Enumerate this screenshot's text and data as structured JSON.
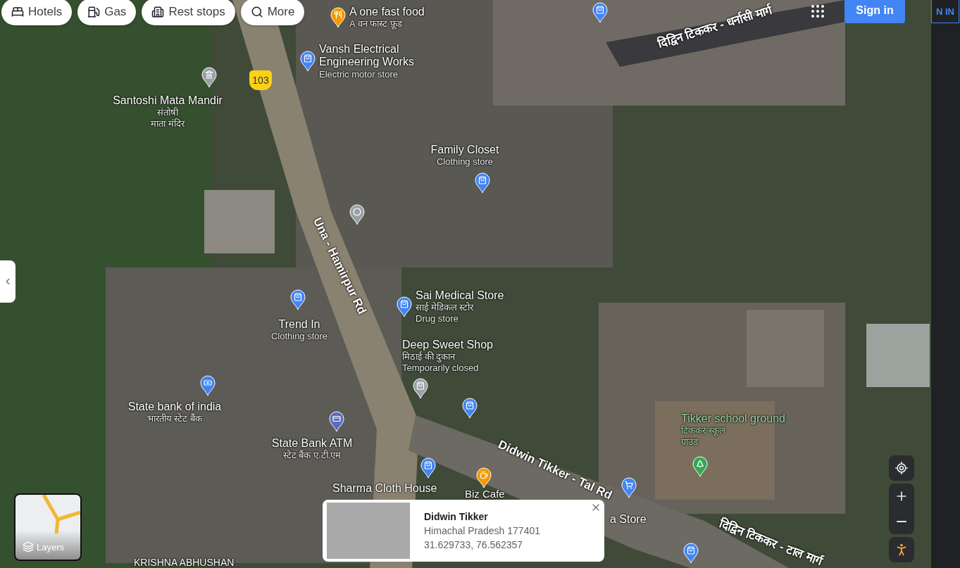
{
  "chips": [
    {
      "label": "Hotels",
      "kind": "hotel"
    },
    {
      "label": "Gas",
      "kind": "gas"
    },
    {
      "label": "Rest stops",
      "kind": "rest"
    },
    {
      "label": "More",
      "kind": "search"
    }
  ],
  "account": {
    "sign_in": "Sign in",
    "edge_text": "N IN"
  },
  "route_shield": "103",
  "roads": [
    {
      "label": "Una - Hamirpur Rd"
    },
    {
      "label": "दिद्विन टिककर - धर्नासी मार्ग"
    },
    {
      "label": "Didwin Tikker - Tal Rd"
    },
    {
      "label": "दिद्विन टिककर - टाल मार्ग"
    }
  ],
  "places": [
    {
      "name": "A one fast food",
      "lines": [
        "A वन फास्ट फ़ूड"
      ],
      "kind": "food",
      "color": "#f29900"
    },
    {
      "name": "Vansh Electrical Engineering Works",
      "lines": [
        "Electric motor store"
      ],
      "kind": "shop",
      "color": "#4285f4"
    },
    {
      "name": "Santoshi Mata Mandir",
      "lines": [
        "संतोषी",
        "माता मंदिर"
      ],
      "kind": "temple",
      "color": "#9aa0a6"
    },
    {
      "name": "Family Closet",
      "lines": [
        "Clothing store"
      ],
      "kind": "shop",
      "color": "#4285f4"
    },
    {
      "name": "Sai Medical Store",
      "lines": [
        "साई मेडिकल स्टोर",
        "Drug store"
      ],
      "kind": "shop",
      "color": "#4285f4"
    },
    {
      "name": "Trend In",
      "lines": [
        "Clothing store"
      ],
      "kind": "shop",
      "color": "#4285f4"
    },
    {
      "name": "Deep Sweet Shop",
      "lines": [
        "मिठाई की दुकान",
        "Temporarily closed"
      ],
      "kind": "shop",
      "color": "#9aa0a6"
    },
    {
      "name": "State bank of india",
      "lines": [
        "भारतीय स्टेट बैंक"
      ],
      "kind": "bank",
      "color": "#4285f4"
    },
    {
      "name": "State Bank ATM",
      "lines": [
        "स्टेट बैंक ए.टी.एम"
      ],
      "kind": "atm",
      "color": "#5c6bc0"
    },
    {
      "name": "Sharma Cloth House",
      "kind": "shop",
      "color": "#4285f4"
    },
    {
      "name": "Biz Cafe",
      "kind": "cafe",
      "color": "#f29900"
    },
    {
      "name": "a Store",
      "kind": "cart",
      "color": "#4285f4"
    },
    {
      "name": "Tikker school ground",
      "lines": [
        "टिककर स्कूल",
        "ग्राउंड"
      ],
      "kind": "park",
      "color": "#34a853"
    },
    {
      "name": "KRISHNA ABHUSHAN"
    }
  ],
  "extra_pins": [
    {
      "kind": "shop",
      "color": "#4285f4"
    },
    {
      "kind": "shop",
      "color": "#4285f4"
    },
    {
      "kind": "shop",
      "color": "#4285f4"
    },
    {
      "kind": "dot",
      "color": "#9aa0a6"
    }
  ],
  "layers": {
    "label": "Layers"
  },
  "info_card": {
    "title": "Didwin Tikker",
    "address": "Himachal Pradesh 177401",
    "coordinates": "31.629733, 76.562357"
  }
}
